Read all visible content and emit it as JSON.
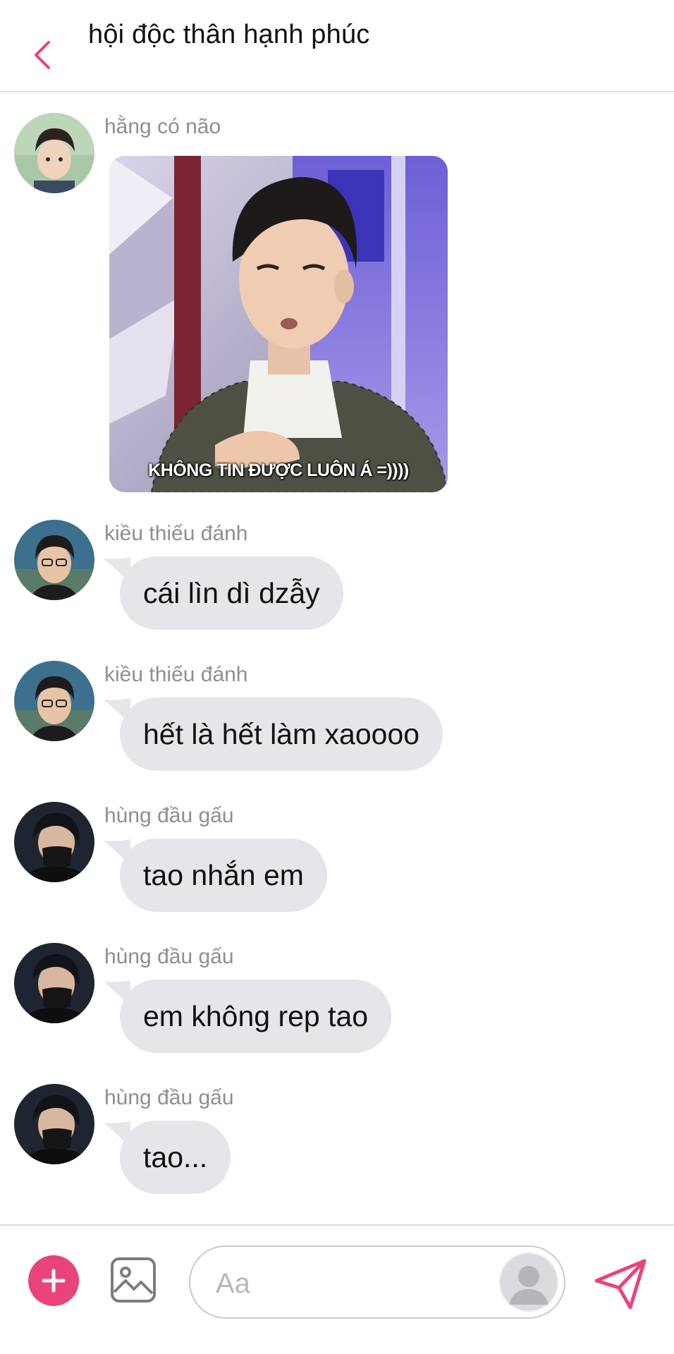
{
  "header": {
    "title": "hội độc thân hạnh phúc"
  },
  "messages": [
    {
      "sender": "hằng có não",
      "type": "image",
      "caption": "KHÔNG TIN ĐƯỢC LUÔN Á =))))"
    },
    {
      "sender": "kiều thiếu đánh",
      "type": "text",
      "text": "cái lìn dì dzẫy"
    },
    {
      "sender": "kiều thiếu đánh",
      "type": "text",
      "text": "hết là hết làm xaoooo"
    },
    {
      "sender": "hùng đầu gấu",
      "type": "text",
      "text": "tao nhắn em"
    },
    {
      "sender": "hùng đầu gấu",
      "type": "text",
      "text": "em không rep tao"
    },
    {
      "sender": "hùng đầu gấu",
      "type": "text",
      "text": "tao..."
    }
  ],
  "composer": {
    "placeholder": "Aa",
    "add_icon": "plus-icon",
    "gallery_icon": "image-icon",
    "sticker_icon": "avatar-sticker-icon",
    "send_icon": "paper-plane-icon"
  },
  "colors": {
    "accent": "#e8447a",
    "bubble": "#e5e5ea",
    "sender_text": "#8e8e93"
  }
}
